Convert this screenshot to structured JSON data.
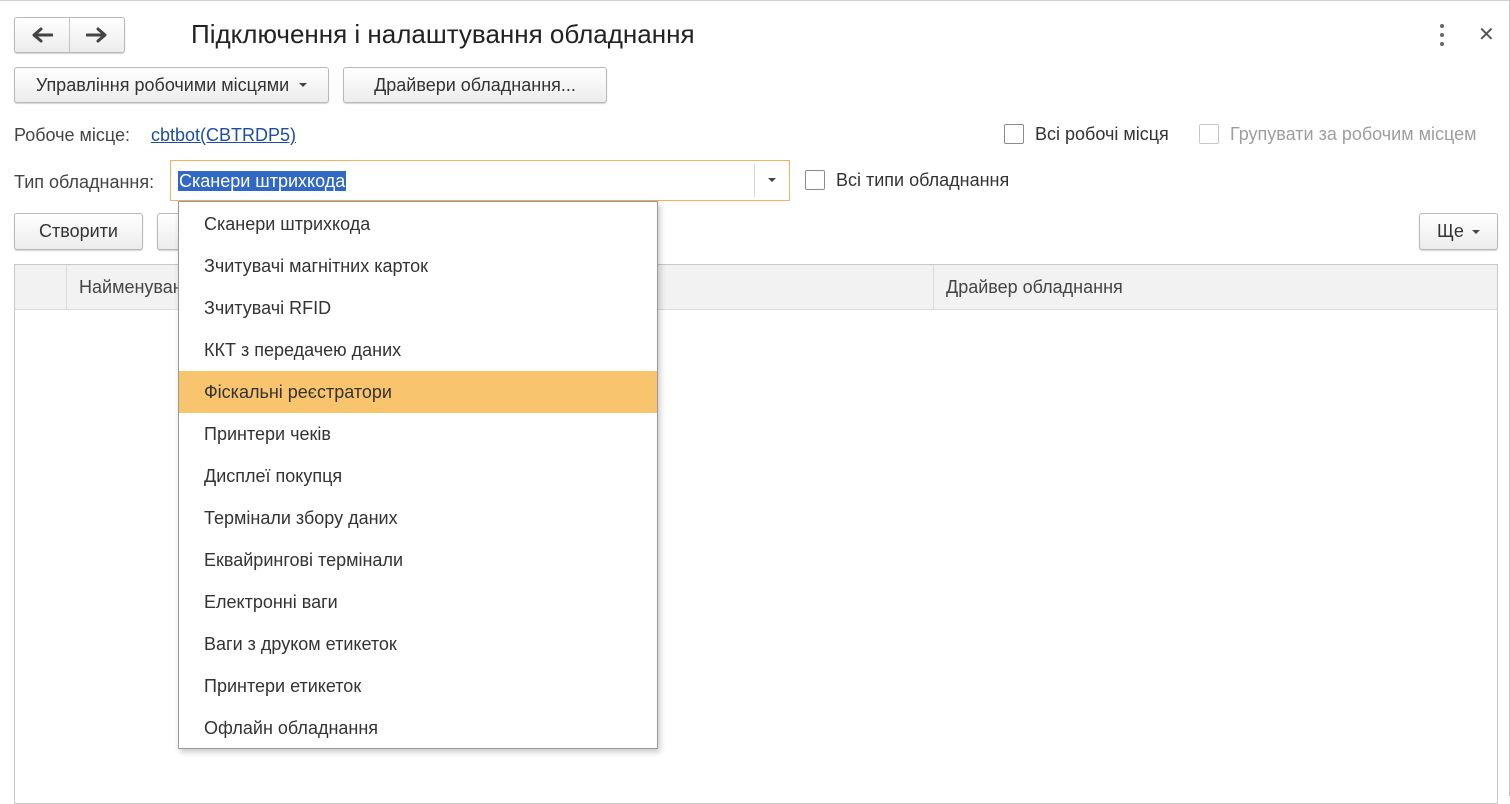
{
  "window": {
    "title": "Підключення і налаштування обладнання"
  },
  "toolbar": {
    "workplaces_menu_label": "Управління робочими місцями",
    "drivers_button_label": "Драйвери обладнання..."
  },
  "workplace": {
    "label": "Робоче місце:",
    "value": "cbtbot(CBTRDP5)",
    "all_workplaces_label": "Всі робочі місця",
    "all_workplaces_checked": false,
    "group_by_workplace_label": "Групувати за робочим місцем",
    "group_by_workplace_checked": false,
    "group_by_workplace_enabled": false
  },
  "equipment_type": {
    "label": "Тип обладнання:",
    "value": "Сканери штрихкода",
    "all_types_label": "Всі типи обладнання",
    "all_types_checked": false
  },
  "list_commands": {
    "create_label": "Створити",
    "more_label": "Ще"
  },
  "table": {
    "columns": [
      "Найменування",
      "Драйвер обладнання"
    ],
    "rows": []
  },
  "dropdown": {
    "highlighted_index": 4,
    "options": [
      "Сканери штрихкода",
      "Зчитувачі магнітних карток",
      "Зчитувачі RFID",
      "ККТ з передачею даних",
      "Фіскальні реєстратори",
      "Принтери чеків",
      "Дисплеї покупця",
      "Термінали збору даних",
      "Еквайрингові термінали",
      "Електронні ваги",
      "Ваги з друком етикеток",
      "Принтери етикеток",
      "Офлайн обладнання"
    ]
  },
  "colors": {
    "selection_bg": "#3168c6",
    "focus_border": "#f0b25a",
    "highlight_bg": "#f9c46e",
    "link": "#1f4ea0"
  }
}
